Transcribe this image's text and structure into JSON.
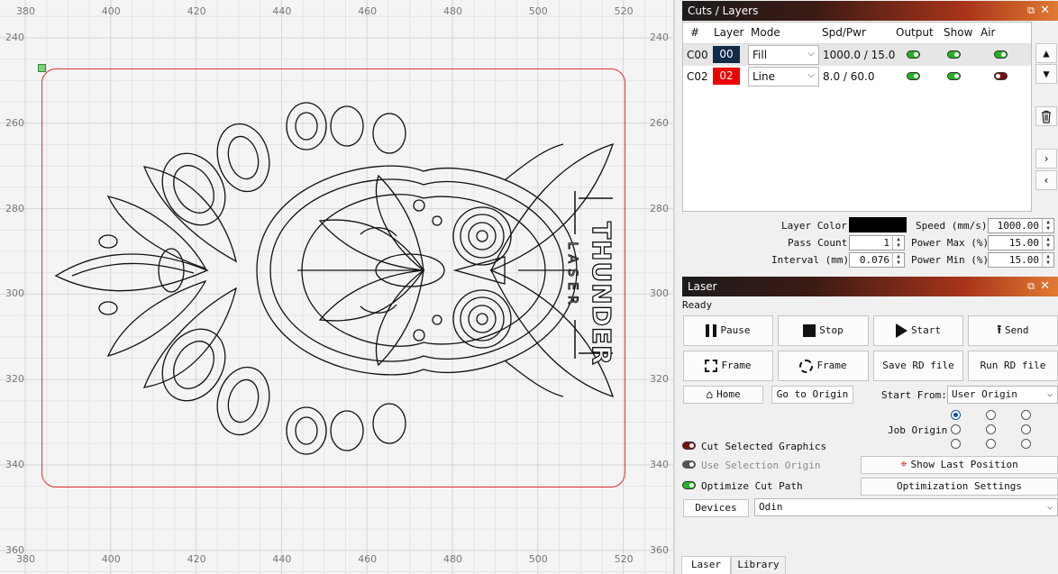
{
  "ruler": {
    "x_labels": [
      "380",
      "400",
      "420",
      "440",
      "460",
      "480",
      "500",
      "520"
    ],
    "y_labels": [
      "240",
      "260",
      "280",
      "300",
      "320",
      "340",
      "360"
    ]
  },
  "design": {
    "logo_title": "THUNDER",
    "logo_subtitle": "LASER"
  },
  "cuts_panel": {
    "title": "Cuts / Layers",
    "columns": [
      "#",
      "Layer",
      "Mode",
      "Spd/Pwr",
      "Output",
      "Show",
      "Air"
    ],
    "rows": [
      {
        "id": "C00",
        "layer": "00",
        "color": "#102a4a",
        "mode": "Fill",
        "spdpwr": "1000.0 / 15.0",
        "output": true,
        "show": true,
        "air": true
      },
      {
        "id": "C02",
        "layer": "02",
        "color": "#ee0000",
        "mode": "Line",
        "spdpwr": "8.0 / 60.0",
        "output": true,
        "show": true,
        "air": false
      }
    ],
    "props": {
      "layer_color_label": "Layer Color",
      "layer_color": "#000000",
      "pass_count_label": "Pass Count",
      "pass_count": "1",
      "interval_label": "Interval (mm)",
      "interval": "0.076",
      "speed_label": "Speed (mm/s)",
      "speed": "1000.00",
      "power_max_label": "Power Max (%)",
      "power_max": "15.00",
      "power_min_label": "Power Min (%)",
      "power_min": "15.00"
    }
  },
  "laser_panel": {
    "title": "Laser",
    "status": "Ready",
    "buttons": {
      "pause": "Pause",
      "stop": "Stop",
      "start": "Start",
      "send": "Send",
      "frame1": "Frame",
      "frame2": "Frame",
      "save_rd": "Save RD file",
      "run_rd": "Run RD file",
      "home": "Home",
      "go_origin": "Go to Origin",
      "show_last": "Show Last Position",
      "opt_settings": "Optimization Settings",
      "devices": "Devices"
    },
    "start_from_label": "Start From:",
    "start_from": "User Origin",
    "job_origin_label": "Job Origin",
    "job_origin_selected": 0,
    "cut_selected": "Cut Selected Graphics",
    "cut_selected_on": false,
    "use_selection_origin": "Use Selection Origin",
    "use_selection_origin_on": false,
    "optimize_cut_path": "Optimize Cut Path",
    "optimize_cut_path_on": true,
    "device": "Odin"
  },
  "tabs": [
    "Laser",
    "Library"
  ],
  "colors": {
    "toggle_on": "#22b422",
    "toggle_off": "#7a1010",
    "accent": "#0a56b0",
    "boundary": "#e03030"
  }
}
